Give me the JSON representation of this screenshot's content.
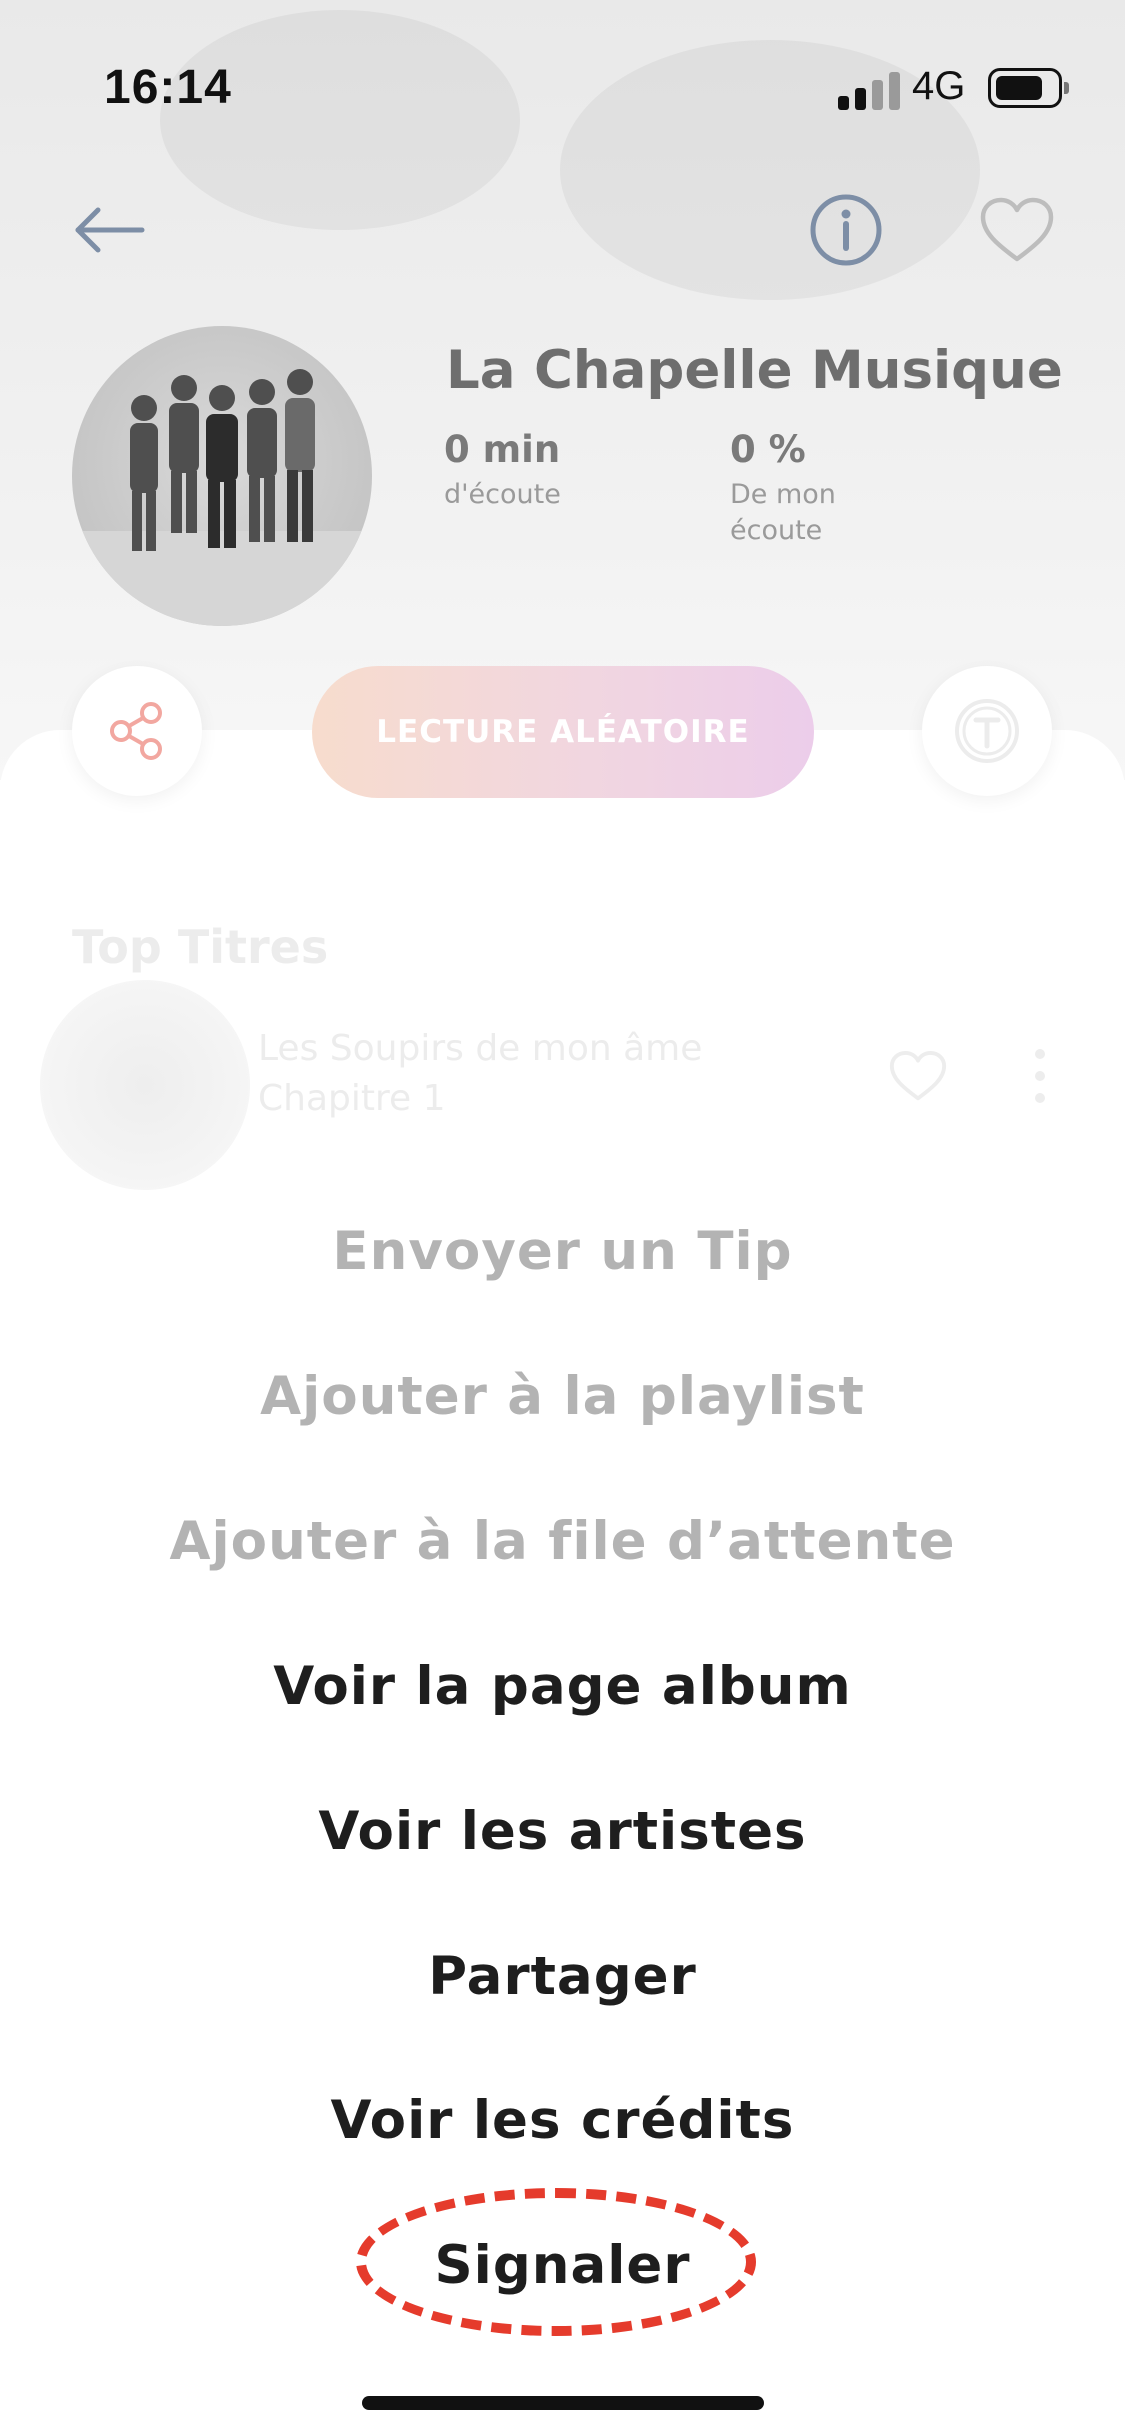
{
  "status_bar": {
    "time": "16:14",
    "network": "4G"
  },
  "header": {
    "back_icon": "arrow-left-icon",
    "info_icon": "info-circle-icon",
    "favorite_icon": "heart-outline-icon"
  },
  "artist": {
    "name": "La Chapelle Musique",
    "stats": [
      {
        "value": "0 min",
        "label": "d'écoute"
      },
      {
        "value": "0 %",
        "label": "De mon\nécoute"
      }
    ]
  },
  "actions": {
    "share_icon": "share-icon",
    "shuffle_label": "LECTURE ALÉATOIRE",
    "tip_icon": "tip-token-icon"
  },
  "top_tracks": {
    "title": "Top Titres",
    "items": [
      {
        "title": "Les Soupirs de mon âme",
        "subtitle": "Chapitre 1"
      }
    ]
  },
  "menu": {
    "items": [
      {
        "label": "Envoyer un Tip",
        "enabled": false
      },
      {
        "label": "Ajouter à la playlist",
        "enabled": false
      },
      {
        "label": "Ajouter à la file d’attente",
        "enabled": false
      },
      {
        "label": "Voir la page album",
        "enabled": true
      },
      {
        "label": "Voir les artistes",
        "enabled": true
      },
      {
        "label": "Partager",
        "enabled": true
      },
      {
        "label": "Voir les crédits",
        "enabled": true
      },
      {
        "label": "Signaler",
        "enabled": true
      }
    ]
  },
  "colors": {
    "highlight": "#e53b2c",
    "share_accent": "#f2a7a0",
    "shuffle_gradient_start": "#f7dccd",
    "shuffle_gradient_end": "#eccdea",
    "enabled_text": "#1e1e1e",
    "disabled_text": "#b3b3b3"
  }
}
